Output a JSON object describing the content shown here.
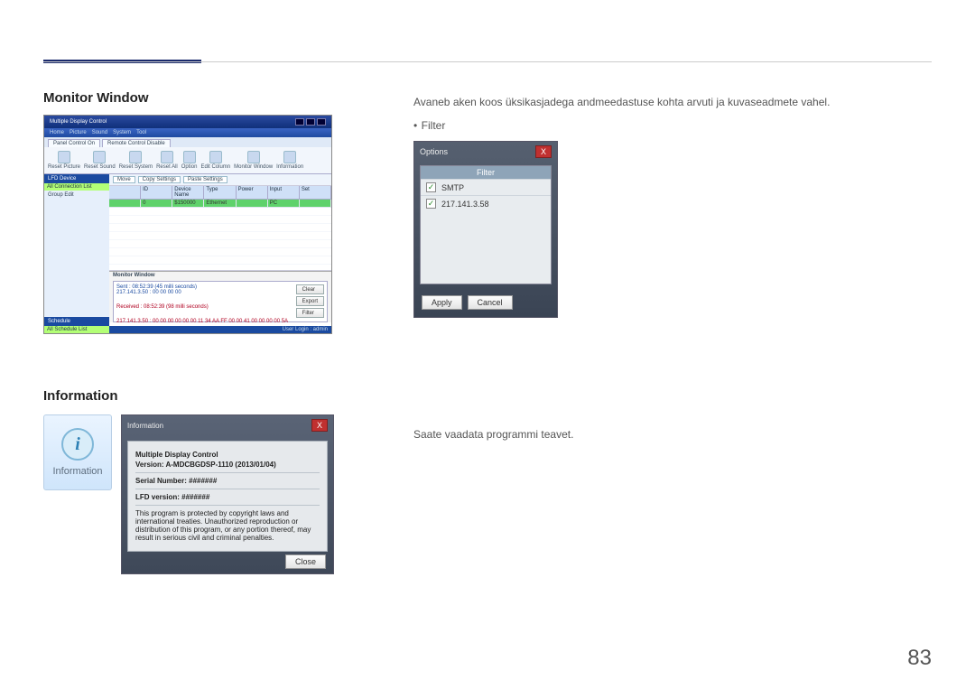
{
  "section1": {
    "heading": "Monitor Window"
  },
  "section2": {
    "heading": "Information"
  },
  "right1": {
    "desc": "Avaneb aken koos üksikasjadega andmeedastuse kohta arvuti ja kuvaseadmete vahel.",
    "bullet_prefix": "•",
    "bullet_label": "Filter"
  },
  "right2": {
    "desc": "Saate vaadata programmi teavet."
  },
  "app": {
    "title": "Multiple Display Control",
    "menu": [
      "Home",
      "Picture",
      "Sound",
      "System",
      "Tool"
    ],
    "tabs": [
      "Panel Control",
      "Remote Control"
    ],
    "tab_vals": [
      "On",
      "Disable"
    ],
    "ribbon": [
      "Reset Picture",
      "Reset Sound",
      "Reset System",
      "Reset All",
      "Option",
      "Edit Column",
      "Monitor Window",
      "Information"
    ],
    "sidebar": {
      "lfd": "LFD Device",
      "conn": "All Connection List",
      "group_lbl": "Group",
      "group_edit": "Edit",
      "schedule": "Schedule",
      "sched_list": "All Schedule List"
    },
    "toolbar2": [
      "Move",
      "Copy Settings",
      "Paste Settings"
    ],
    "grid": {
      "cols": [
        "",
        "ID",
        "Device Name",
        "Type",
        "Power",
        "Input",
        "Set"
      ],
      "row": [
        "",
        "0",
        "$150000",
        "Ethernet",
        "",
        "PC",
        ""
      ]
    },
    "monitor": {
      "title": "Monitor Window",
      "sent_header": "Sent : 08:52:39 (45 milli seconds)",
      "sent_detail": "217.141.3.50 : 00 00 00 00",
      "recv_header": "Received : 08:52:39 (98 milli seconds)",
      "recv_detail": "217.141.3.50 : 00 00 00 00 00 00 11 34 AA FF 00 00 41 00 00 00 00 5A",
      "btns": [
        "Clear",
        "Export",
        "Filter"
      ]
    },
    "status": "User Login : admin"
  },
  "filter_dlg": {
    "title": "Options",
    "header": "Filter",
    "rows": [
      "SMTP",
      "217.141.3.58"
    ],
    "apply": "Apply",
    "cancel": "Cancel",
    "close": "X"
  },
  "info_tile": {
    "label": "Information"
  },
  "info_dlg": {
    "title": "Information",
    "close": "X",
    "app_name": "Multiple Display Control",
    "version_lbl": "Version: A-MDCBGDSP-1110 (2013/01/04)",
    "serial_lbl": "Serial Number: #######",
    "lfd_lbl": "LFD version: #######",
    "legal": "This program is protected by copyright laws and international treaties. Unauthorized reproduction or distribution of this program, or any portion thereof, may result in serious civil and criminal penalties.",
    "close_btn": "Close"
  },
  "page_number": "83"
}
